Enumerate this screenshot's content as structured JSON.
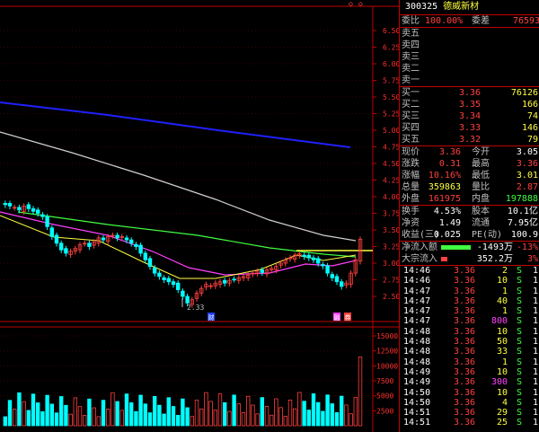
{
  "chart_header": {
    "diamond_icons": "◇ ◇"
  },
  "price_axis": {
    "ticks": [
      "6.50",
      "6.25",
      "6.00",
      "5.75",
      "5.50",
      "5.25",
      "5.00",
      "4.75",
      "4.50",
      "4.25",
      "4.00",
      "3.75",
      "3.50",
      "3.25",
      "3.00",
      "2.75",
      "2.50"
    ],
    "min_label": "2.33",
    "badges": [
      "财",
      "融",
      "券"
    ]
  },
  "volume_axis": {
    "ticks": [
      "15000",
      "12500",
      "10000",
      "7500",
      "5000",
      "2500"
    ]
  },
  "colors": {
    "up": "#ff4040",
    "down": "#00ffff",
    "ma_white": "#d0d0d0",
    "ma_blue": "#2020ff",
    "ma_yellow": "#ffff40",
    "ma_green": "#40ff40",
    "ma_magenta": "#ff40ff"
  },
  "stock": {
    "code": "300325",
    "name": "德威新材"
  },
  "order_book": {
    "ratio": {
      "label": "委比",
      "value": "100.00%",
      "diff_label": "委差",
      "diff_value": "76593"
    },
    "sell": [
      {
        "label": "卖五",
        "price": "",
        "qty": ""
      },
      {
        "label": "卖四",
        "price": "",
        "qty": ""
      },
      {
        "label": "卖三",
        "price": "",
        "qty": ""
      },
      {
        "label": "卖二",
        "price": "",
        "qty": ""
      },
      {
        "label": "卖一",
        "price": "",
        "qty": ""
      }
    ],
    "buy": [
      {
        "label": "买一",
        "price": "3.36",
        "qty": "76126"
      },
      {
        "label": "买二",
        "price": "3.35",
        "qty": "166"
      },
      {
        "label": "买三",
        "price": "3.34",
        "qty": "74"
      },
      {
        "label": "买四",
        "price": "3.33",
        "qty": "146"
      },
      {
        "label": "买五",
        "price": "3.32",
        "qty": "79"
      }
    ]
  },
  "quote": [
    {
      "l1": "现价",
      "v1": "3.36",
      "c1": "red",
      "l2": "今开",
      "v2": "3.05",
      "c2": "wht"
    },
    {
      "l1": "涨跌",
      "v1": "0.31",
      "c1": "red",
      "l2": "最高",
      "v2": "3.36",
      "c2": "red"
    },
    {
      "l1": "涨幅",
      "v1": "10.16%",
      "c1": "red",
      "l2": "最低",
      "v2": "3.01",
      "c2": "yel"
    },
    {
      "l1": "总量",
      "v1": "359863",
      "c1": "yel",
      "l2": "量比",
      "v2": "2.87",
      "c2": "red"
    },
    {
      "l1": "外盘",
      "v1": "161975",
      "c1": "red",
      "l2": "内盘",
      "v2": "197888",
      "c2": "green"
    }
  ],
  "fundamentals": [
    {
      "l1": "换手",
      "v1": "4.53%",
      "l2": "股本",
      "v2": "10.1亿"
    },
    {
      "l1": "净资",
      "v1": "1.49",
      "l2": "流通",
      "v2": "7.95亿"
    },
    {
      "l1": "收益(三)",
      "v1": "0.025",
      "l2": "PE(动)",
      "v2": "100.9"
    }
  ],
  "flow": [
    {
      "label": "净流入额",
      "value": "-1493万",
      "pct": "-13%",
      "bar_color": "#40ff40",
      "fill": 0.55
    },
    {
      "label": "大宗流入",
      "value": "352.2万",
      "pct": "3%",
      "bar_color": "#ff4040",
      "fill": 0.12
    }
  ],
  "ticks": [
    {
      "time": "14:46",
      "price": "3.36",
      "vol": "2",
      "dir": "S",
      "n": "1"
    },
    {
      "time": "14:46",
      "price": "3.36",
      "vol": "10",
      "dir": "S",
      "n": "1"
    },
    {
      "time": "14:47",
      "price": "3.36",
      "vol": "1",
      "dir": "S",
      "n": "1"
    },
    {
      "time": "14:47",
      "price": "3.36",
      "vol": "40",
      "dir": "S",
      "n": "1"
    },
    {
      "time": "14:47",
      "price": "3.36",
      "vol": "1",
      "dir": "S",
      "n": "1"
    },
    {
      "time": "14:47",
      "price": "3.36",
      "vol": "800",
      "dir": "S",
      "n": "1"
    },
    {
      "time": "14:48",
      "price": "3.36",
      "vol": "10",
      "dir": "S",
      "n": "1"
    },
    {
      "time": "14:48",
      "price": "3.36",
      "vol": "50",
      "dir": "S",
      "n": "1"
    },
    {
      "time": "14:48",
      "price": "3.36",
      "vol": "33",
      "dir": "S",
      "n": "1"
    },
    {
      "time": "14:48",
      "price": "3.36",
      "vol": "1",
      "dir": "S",
      "n": "1"
    },
    {
      "time": "14:49",
      "price": "3.36",
      "vol": "10",
      "dir": "S",
      "n": "1"
    },
    {
      "time": "14:49",
      "price": "3.36",
      "vol": "300",
      "dir": "S",
      "n": "1"
    },
    {
      "time": "14:50",
      "price": "3.36",
      "vol": "10",
      "dir": "S",
      "n": "1"
    },
    {
      "time": "14:50",
      "price": "3.36",
      "vol": "4",
      "dir": "S",
      "n": "1"
    },
    {
      "time": "14:51",
      "price": "3.36",
      "vol": "29",
      "dir": "S",
      "n": "1"
    },
    {
      "time": "14:51",
      "price": "3.36",
      "vol": "25",
      "dir": "S",
      "n": "1"
    }
  ]
}
